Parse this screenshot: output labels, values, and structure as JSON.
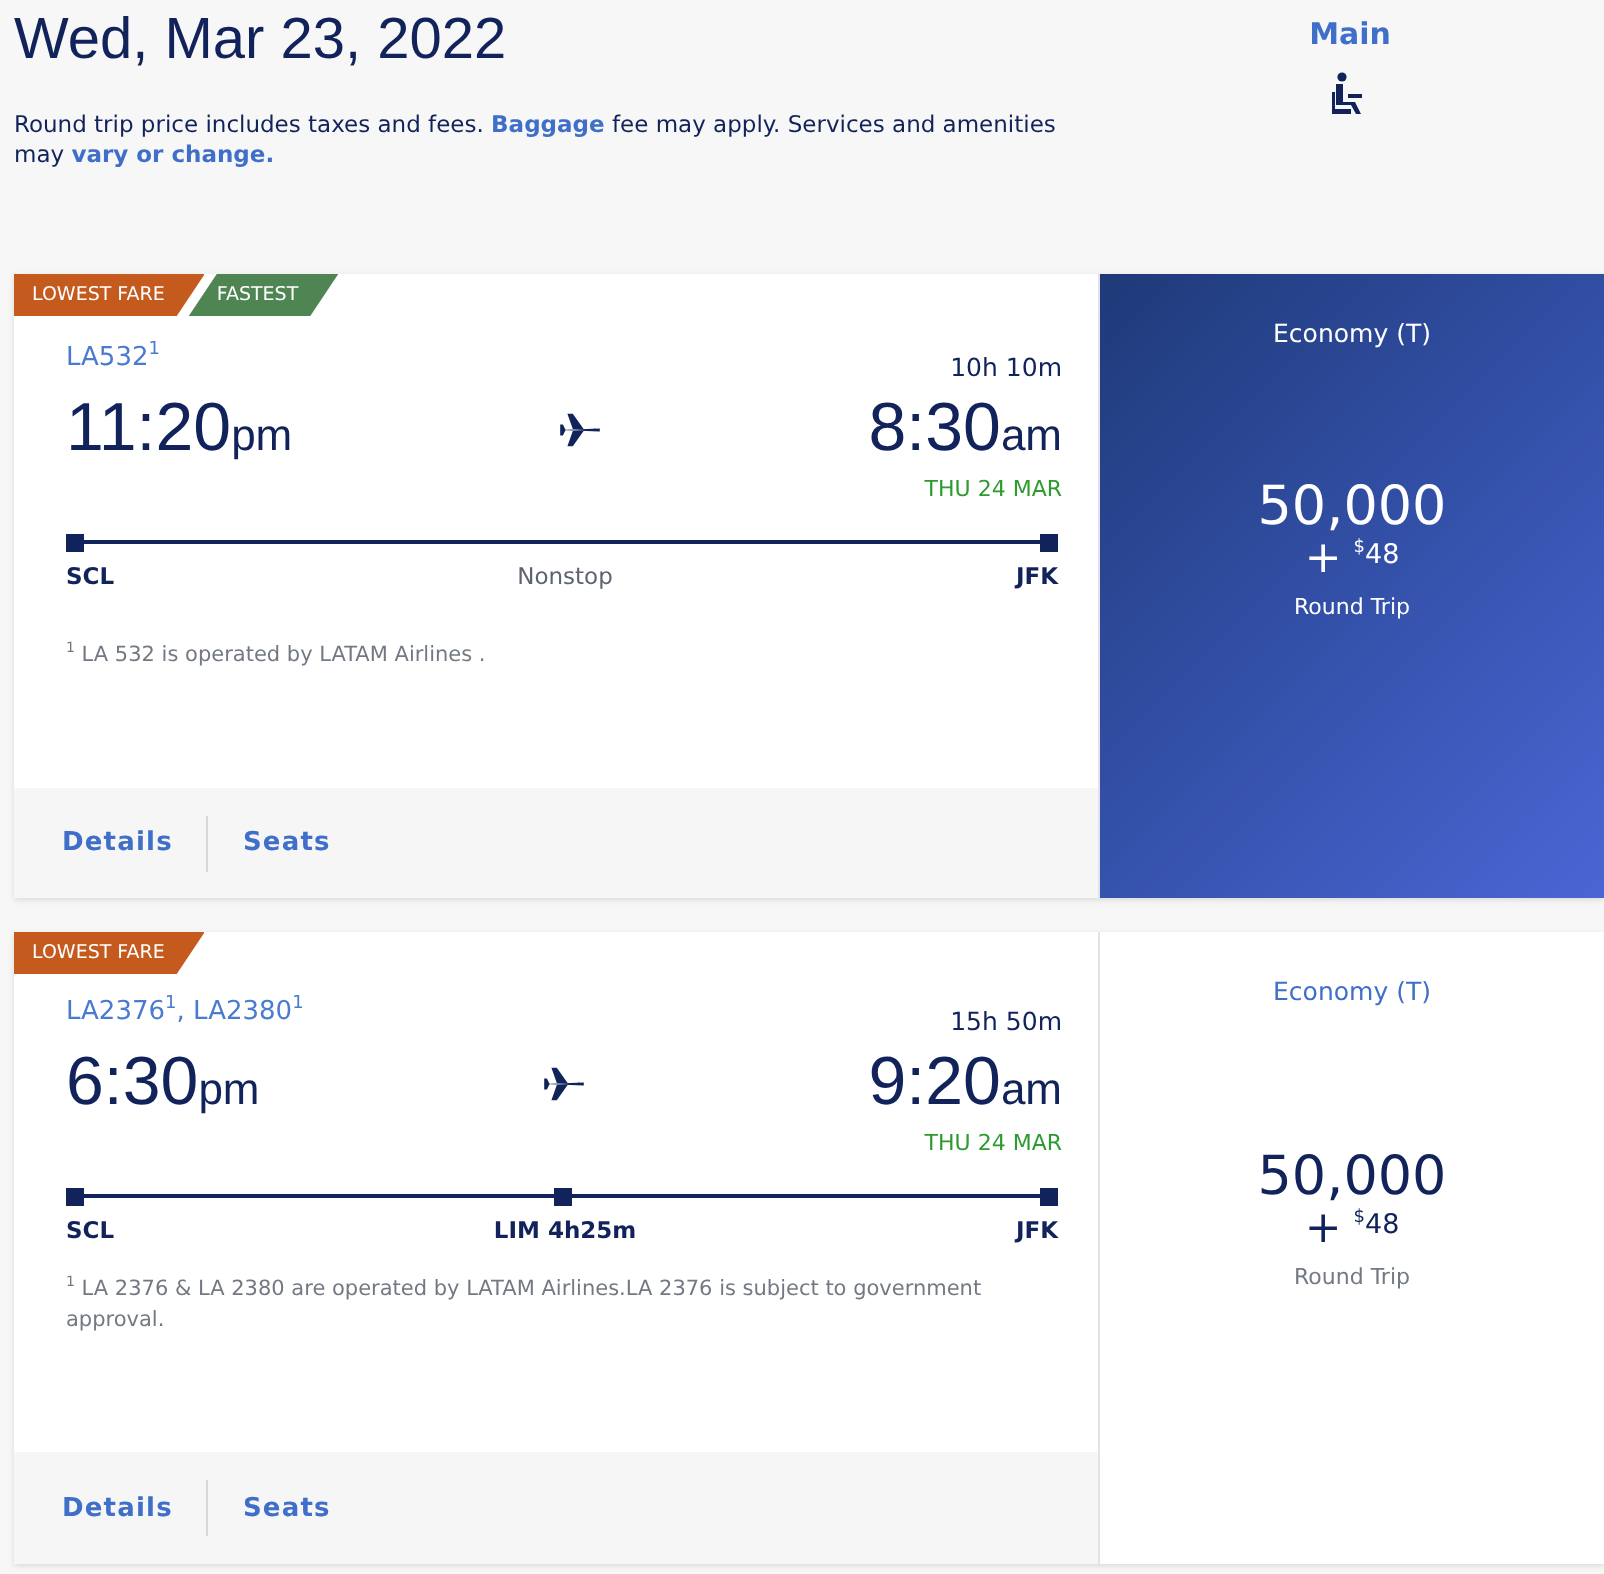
{
  "header": {
    "date": "Wed, Mar 23, 2022",
    "notice": "Round trip price includes taxes and fees. **Baggage** fee may apply. Services and amenities may",
    "notice_link": "vary or change.",
    "cabin": "Main"
  },
  "flights": [
    {
      "badges": [
        {
          "label": "LOWEST FARE",
          "color": "#c55a1e"
        },
        {
          "label": "FASTEST",
          "color": "#4f8553"
        }
      ],
      "flight_numbers": "LA532$^{1}$",
      "duration": "10h 10m",
      "depart_time": "11:20",
      "depart_ampm": "pm",
      "arrive_time": "8:30",
      "arrive_ampm": "am",
      "arrive_date": "THU 24 MAR",
      "stops": [
        {
          "code": "SCL"
        },
        {
          "code": "Nonstop",
          "kind": "label"
        },
        {
          "code": "JFK"
        }
      ],
      "footnote": "$^{1}$   LA 532 is operated by LATAM Airlines .",
      "actions": [
        "Details",
        "Seats"
      ],
      "fare": {
        "cabin": "Economy (T)",
        "miles": "50,000",
        "plus": "+",
        "currency": "$",
        "amount": "48",
        "trip": "Round Trip",
        "selected": true
      }
    },
    {
      "badges": [
        {
          "label": "LOWEST FARE",
          "color": "#c55a1e"
        }
      ],
      "flight_numbers": "LA2376$^{1}$, LA2380$^{1}$",
      "duration": "15h 50m",
      "depart_time": "6:30",
      "depart_ampm": "pm",
      "arrive_time": "9:20",
      "arrive_ampm": "am",
      "arrive_date": "THU 24 MAR",
      "stops": [
        {
          "code": "SCL"
        },
        {
          "code": "LIM 4h25m",
          "kind": "stop"
        },
        {
          "code": "JFK"
        }
      ],
      "footnote": "$^{1}$  LA 2376 & LA 2380 are operated by LATAM Airlines.LA 2376 is subject to government approval.",
      "actions": [
        "Details",
        "Seats"
      ],
      "fare": {
        "cabin": "Economy (T)",
        "miles": "50,000",
        "plus": "+",
        "currency": "$",
        "amount": "48",
        "trip": "Round Trip",
        "selected": false
      }
    }
  ]
}
